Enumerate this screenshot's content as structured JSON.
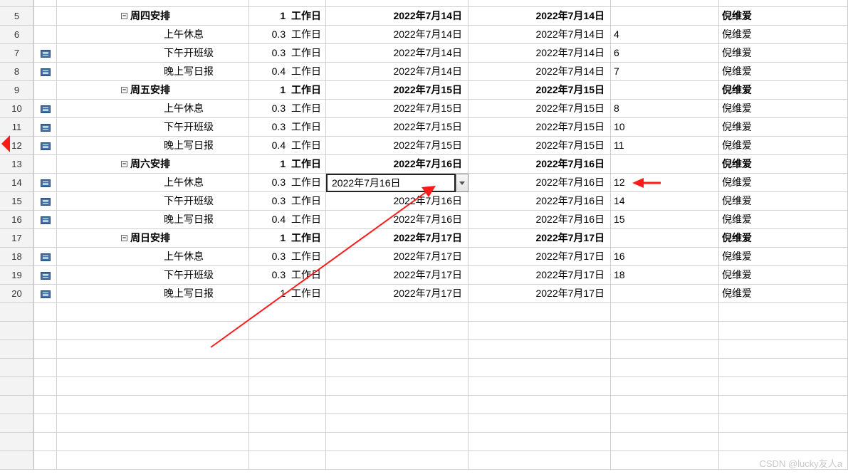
{
  "unit": "工作日",
  "selected": {
    "value": "2022年7月16日"
  },
  "watermark": "CSDN @lucky友人a",
  "rows": [
    {
      "n": "",
      "partial": true,
      "icon": false,
      "parent": false,
      "task": "",
      "dur": "",
      "d1": "",
      "d1b": false,
      "d2": "",
      "d2b": false,
      "pred": "",
      "res": "",
      "resb": false
    },
    {
      "n": "5",
      "icon": false,
      "parent": true,
      "task": "周四安排",
      "dur": "1",
      "d1": "2022年7月14日",
      "d1b": true,
      "d2": "2022年7月14日",
      "d2b": true,
      "pred": "",
      "res": "倪维爱",
      "resb": true
    },
    {
      "n": "6",
      "icon": false,
      "parent": false,
      "task": "上午休息",
      "dur": "0.3",
      "d1": "2022年7月14日",
      "d1b": false,
      "d2": "2022年7月14日",
      "d2b": false,
      "pred": "4",
      "res": "倪维爱",
      "resb": false
    },
    {
      "n": "7",
      "icon": true,
      "parent": false,
      "task": "下午开班级",
      "dur": "0.3",
      "d1": "2022年7月14日",
      "d1b": false,
      "d2": "2022年7月14日",
      "d2b": false,
      "pred": "6",
      "res": "倪维爱",
      "resb": false
    },
    {
      "n": "8",
      "icon": true,
      "parent": false,
      "task": "晚上写日报",
      "dur": "0.4",
      "d1": "2022年7月14日",
      "d1b": false,
      "d2": "2022年7月14日",
      "d2b": false,
      "pred": "7",
      "res": "倪维爱",
      "resb": false
    },
    {
      "n": "9",
      "icon": false,
      "parent": true,
      "task": "周五安排",
      "dur": "1",
      "d1": "2022年7月15日",
      "d1b": true,
      "d2": "2022年7月15日",
      "d2b": true,
      "pred": "",
      "res": "倪维爱",
      "resb": true
    },
    {
      "n": "10",
      "icon": true,
      "parent": false,
      "task": "上午休息",
      "dur": "0.3",
      "d1": "2022年7月15日",
      "d1b": false,
      "d2": "2022年7月15日",
      "d2b": false,
      "pred": "8",
      "res": "倪维爱",
      "resb": false
    },
    {
      "n": "11",
      "icon": true,
      "parent": false,
      "task": "下午开班级",
      "dur": "0.3",
      "d1": "2022年7月15日",
      "d1b": false,
      "d2": "2022年7月15日",
      "d2b": false,
      "pred": "10",
      "res": "倪维爱",
      "resb": false
    },
    {
      "n": "12",
      "icon": true,
      "parent": false,
      "task": "晚上写日报",
      "dur": "0.4",
      "d1": "2022年7月15日",
      "d1b": false,
      "d2": "2022年7月15日",
      "d2b": false,
      "pred": "11",
      "res": "倪维爱",
      "resb": false
    },
    {
      "n": "13",
      "icon": false,
      "parent": true,
      "task": "周六安排",
      "dur": "1",
      "d1": "2022年7月16日",
      "d1b": true,
      "d2": "2022年7月16日",
      "d2b": true,
      "pred": "",
      "res": "倪维爱",
      "resb": true
    },
    {
      "n": "14",
      "icon": true,
      "parent": false,
      "task": "上午休息",
      "dur": "0.3",
      "d1": "2022年7月16日",
      "d1b": false,
      "d2": "2022年7月16日",
      "d2b": false,
      "pred": "12",
      "res": "倪维爱",
      "resb": false,
      "selected": true
    },
    {
      "n": "15",
      "icon": true,
      "parent": false,
      "task": "下午开班级",
      "dur": "0.3",
      "d1": "2022年7月16日",
      "d1b": false,
      "d2": "2022年7月16日",
      "d2b": false,
      "pred": "14",
      "res": "倪维爱",
      "resb": false
    },
    {
      "n": "16",
      "icon": true,
      "parent": false,
      "task": "晚上写日报",
      "dur": "0.4",
      "d1": "2022年7月16日",
      "d1b": false,
      "d2": "2022年7月16日",
      "d2b": false,
      "pred": "15",
      "res": "倪维爱",
      "resb": false
    },
    {
      "n": "17",
      "icon": false,
      "parent": true,
      "task": "周日安排",
      "dur": "1",
      "d1": "2022年7月17日",
      "d1b": true,
      "d2": "2022年7月17日",
      "d2b": true,
      "pred": "",
      "res": "倪维爱",
      "resb": true
    },
    {
      "n": "18",
      "icon": true,
      "parent": false,
      "task": "上午休息",
      "dur": "0.3",
      "d1": "2022年7月17日",
      "d1b": false,
      "d2": "2022年7月17日",
      "d2b": false,
      "pred": "16",
      "res": "倪维爱",
      "resb": false
    },
    {
      "n": "19",
      "icon": true,
      "parent": false,
      "task": "下午开班级",
      "dur": "0.3",
      "d1": "2022年7月17日",
      "d1b": false,
      "d2": "2022年7月17日",
      "d2b": false,
      "pred": "18",
      "res": "倪维爱",
      "resb": false
    },
    {
      "n": "20",
      "icon": true,
      "parent": false,
      "task": "晚上写日报",
      "dur": "1",
      "d1": "2022年7月17日",
      "d1b": false,
      "d2": "2022年7月17日",
      "d2b": false,
      "pred": "",
      "res": "倪维爱",
      "resb": false
    }
  ],
  "empty_rows": 9
}
